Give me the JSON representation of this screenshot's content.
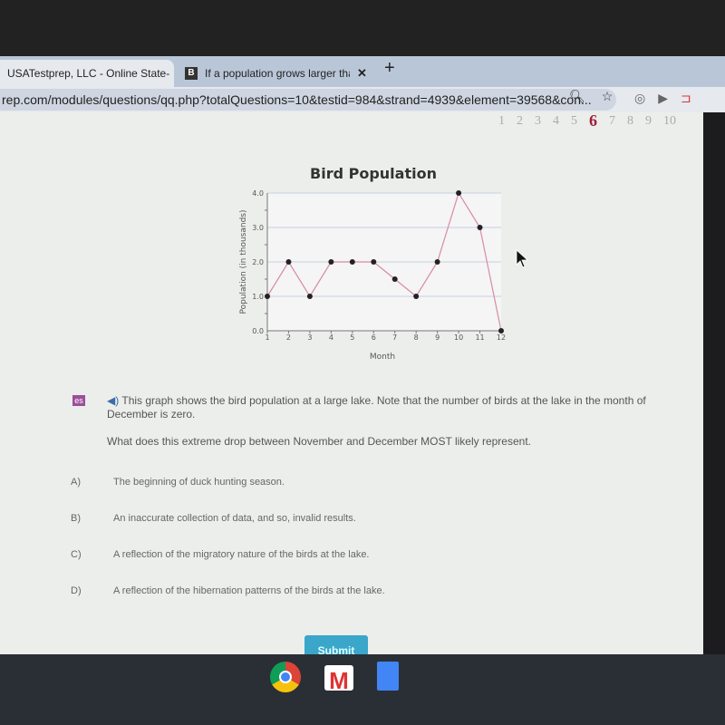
{
  "browser": {
    "tabs": [
      {
        "label": "USATestprep, LLC - Online State-",
        "active": true
      },
      {
        "label": "If a population grows larger than",
        "favicon": "B"
      }
    ],
    "new_tab": "+",
    "close": "✕",
    "url": "rep.com/modules/questions/qq.php?totalQuestions=10&testid=984&strand=4939&element=39568&con..."
  },
  "pager": {
    "pages": [
      "1",
      "2",
      "3",
      "4",
      "5",
      "6",
      "7",
      "8",
      "9",
      "10"
    ],
    "current": "6"
  },
  "chart_data": {
    "type": "line",
    "title": "Bird Population",
    "xlabel": "Month",
    "ylabel": "Population (in thousands)",
    "x": [
      1,
      2,
      3,
      4,
      5,
      6,
      7,
      8,
      9,
      10,
      11,
      12
    ],
    "y": [
      1.0,
      2.0,
      1.0,
      2.0,
      2.0,
      2.0,
      1.5,
      1.0,
      2.0,
      4.0,
      3.0,
      0.0
    ],
    "yticks": [
      "0.0",
      "1.0",
      "2.0",
      "3.0",
      "4.0"
    ],
    "ylim": [
      0,
      4
    ],
    "xlim": [
      1,
      12
    ],
    "grid": true,
    "line_color": "#d98aa6",
    "marker_color": "#222222"
  },
  "question": {
    "badge": "es",
    "text": "This graph shows the bird population at a large lake. Note that the number of birds at the lake in the month of December is zero.",
    "prompt": "What does this extreme drop between November and December MOST likely represent.",
    "options": [
      {
        "letter": "A)",
        "text": "The beginning of duck hunting season."
      },
      {
        "letter": "B)",
        "text": "An inaccurate collection of data, and so, invalid results."
      },
      {
        "letter": "C)",
        "text": "A reflection of the migratory nature of the birds at the lake."
      },
      {
        "letter": "D)",
        "text": "A reflection of the hibernation patterns of the birds at the lake."
      }
    ],
    "submit": "Submit"
  },
  "dock": [
    "chrome-icon",
    "gmail-icon",
    "docs-icon"
  ]
}
